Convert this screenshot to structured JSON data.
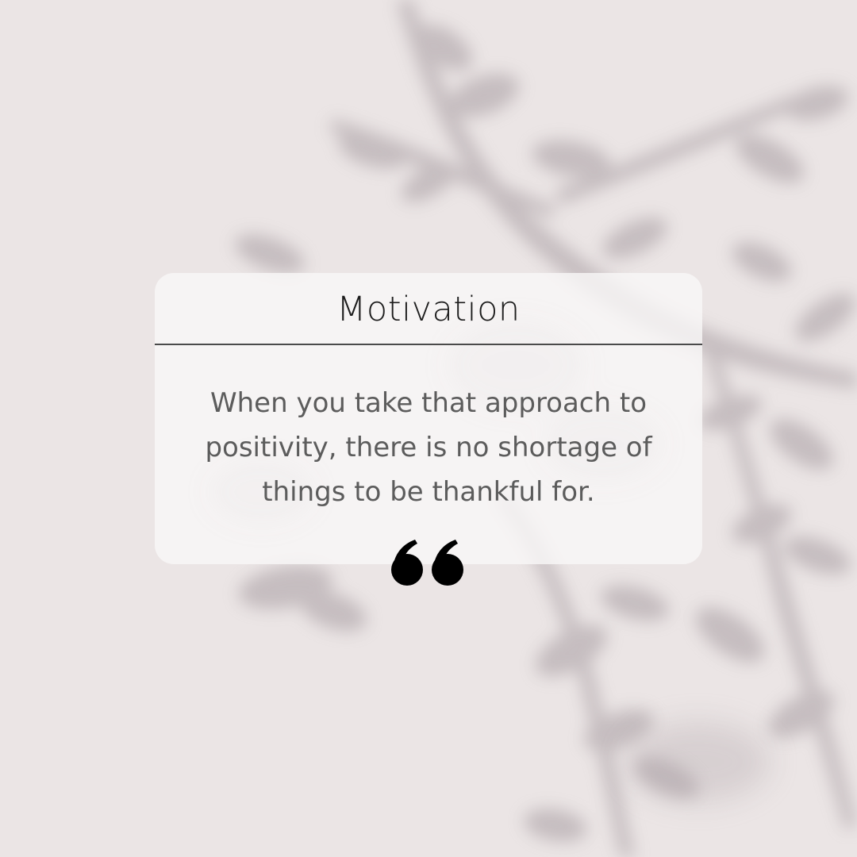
{
  "card": {
    "title": "Motivation",
    "quote": "When you take that approach to positivity, there is no shortage of things to be thankful for."
  },
  "icons": {
    "quote_mark": "quote-mark-icon"
  },
  "colors": {
    "background": "#e9e3e3",
    "card": "#f9f8f7",
    "title": "#1d1d1d",
    "quote_text": "#5c5c5c",
    "quote_mark": "#000000",
    "shadow": "#9c9297"
  }
}
